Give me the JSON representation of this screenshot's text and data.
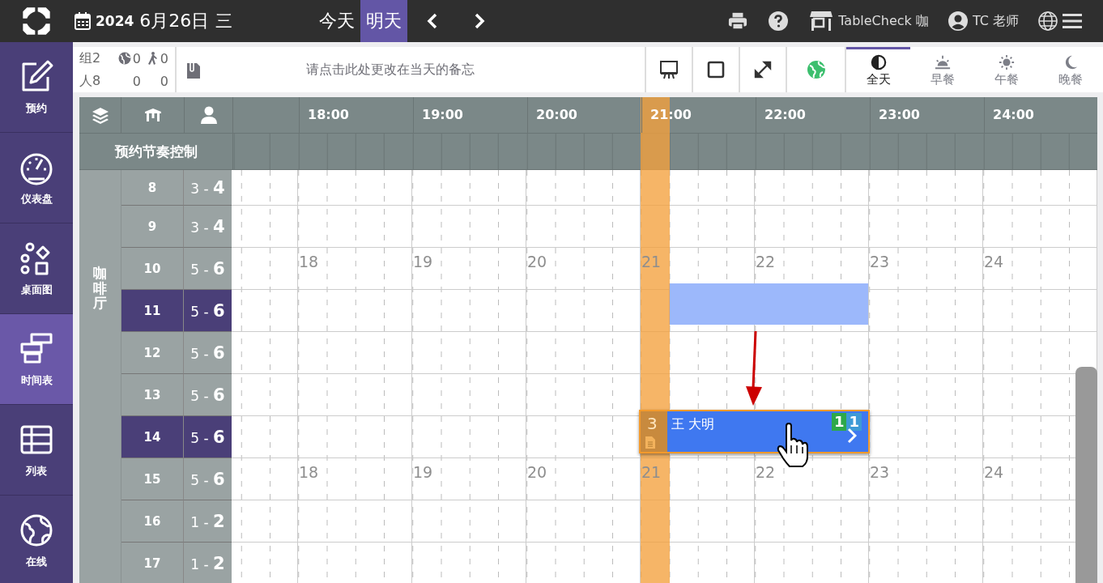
{
  "topbar": {
    "year": "2024",
    "date": "6月26日",
    "weekday": "三",
    "day_buttons": [
      {
        "label": "今天",
        "selected": false
      },
      {
        "label": "明天",
        "selected": true
      }
    ],
    "store": "TableCheck 咖",
    "user": "TC 老师"
  },
  "sidebar": {
    "items": [
      {
        "kind": "edit",
        "label": "预约",
        "selected": false
      },
      {
        "kind": "gauge",
        "label": "仪表盘",
        "selected": false
      },
      {
        "kind": "floor",
        "label": "桌面图",
        "selected": false
      },
      {
        "kind": "timeline",
        "label": "时间表",
        "selected": true
      },
      {
        "kind": "list",
        "label": "列表",
        "selected": false
      },
      {
        "kind": "globe",
        "label": "在线",
        "selected": false
      }
    ]
  },
  "stats": {
    "rows": [
      {
        "label": "组",
        "values": [
          "2",
          "0",
          "0"
        ]
      },
      {
        "label": "人",
        "values": [
          "8",
          "0",
          "0"
        ]
      }
    ]
  },
  "memo": {
    "placeholder": "请点击此处更改在当天的备忘"
  },
  "meal_tabs": [
    {
      "kind": "allday",
      "label": "全天",
      "selected": true
    },
    {
      "kind": "breakfast",
      "label": "早餐",
      "selected": false
    },
    {
      "kind": "lunch",
      "label": "午餐",
      "selected": false
    },
    {
      "kind": "dinner",
      "label": "晚餐",
      "selected": false
    }
  ],
  "grid": {
    "hours": [
      "18:00",
      "19:00",
      "20:00",
      "21:00",
      "22:00",
      "23:00",
      "24:00"
    ],
    "pacing_label": "预约节奏控制",
    "area": "咖啡厅",
    "rows": [
      {
        "table": "8",
        "capacity": "3 - **4**",
        "selected": false
      },
      {
        "table": "9",
        "capacity": "3 - **4**",
        "selected": false
      },
      {
        "table": "10",
        "capacity": "5 - **6**",
        "selected": false,
        "hour_marks": [
          "18",
          "19",
          "20",
          "21",
          "22",
          "23",
          "24"
        ]
      },
      {
        "table": "11",
        "capacity": "5 - **6**",
        "selected": true
      },
      {
        "table": "12",
        "capacity": "5 - **6**",
        "selected": false
      },
      {
        "table": "13",
        "capacity": "5 - **6**",
        "selected": false
      },
      {
        "table": "14",
        "capacity": "5 - **6**",
        "selected": true
      },
      {
        "table": "15",
        "capacity": "5 - **6**",
        "selected": false,
        "hour_marks": [
          "18",
          "19",
          "20",
          "21",
          "22",
          "23",
          "24"
        ]
      },
      {
        "table": "16",
        "capacity": "1 - **2**",
        "selected": false
      },
      {
        "table": "17",
        "capacity": "1 - **2**",
        "selected": false
      }
    ]
  },
  "reservation": {
    "party": "3",
    "name": "王 大明",
    "badges": [
      {
        "text": "1",
        "color": "#2ea84a"
      },
      {
        "text": "1",
        "color": "#3d9ad6"
      }
    ]
  }
}
